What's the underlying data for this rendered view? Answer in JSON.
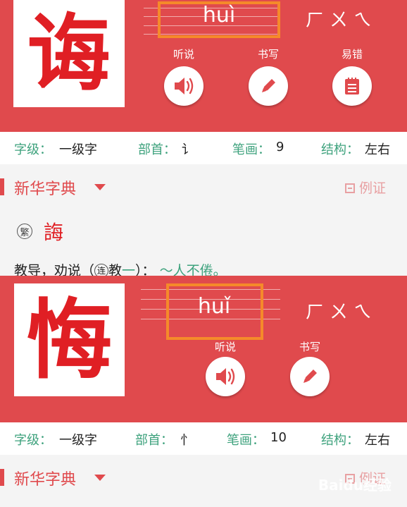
{
  "entry1": {
    "character": "诲",
    "pinyin": "huì",
    "zhuyin": "ㄏㄨㄟ",
    "actions": [
      {
        "label": "听说",
        "icon": "speaker-icon"
      },
      {
        "label": "书写",
        "icon": "pencil-icon"
      },
      {
        "label": "易错",
        "icon": "notepad-icon"
      }
    ],
    "info": {
      "level_key": "字级",
      "level_value": "一级字",
      "radical_key": "部首",
      "radical_value": "讠",
      "strokes_key": "笔画",
      "strokes_value": "9",
      "structure_key": "结构",
      "structure_value": "左右",
      "colon": "："
    },
    "dict_title": "新华字典",
    "example_label": "例证",
    "fan_label": "繁",
    "traditional": "誨",
    "definition": {
      "part1": "教导，劝说（",
      "lian": "连",
      "part2": "教",
      "dash": "一",
      "part3": "）：",
      "example": "～人不倦。"
    }
  },
  "entry2": {
    "character": "悔",
    "pinyin": "huǐ",
    "zhuyin": "ㄏㄨㄟ",
    "actions": [
      {
        "label": "听说",
        "icon": "speaker-icon"
      },
      {
        "label": "书写",
        "icon": "pencil-icon"
      }
    ],
    "info": {
      "level_key": "字级",
      "level_value": "一级字",
      "radical_key": "部首",
      "radical_value": "忄",
      "strokes_key": "笔画",
      "strokes_value": "10",
      "structure_key": "结构",
      "structure_value": "左右",
      "colon": "："
    },
    "dict_title": "新华字典",
    "example_label": "例证"
  },
  "watermark": "Baidu经验",
  "colors": {
    "header_red": "#e04a4d",
    "char_red": "#e01f24",
    "label_green": "#3ea27d",
    "highlight_orange": "#f58a2a"
  }
}
